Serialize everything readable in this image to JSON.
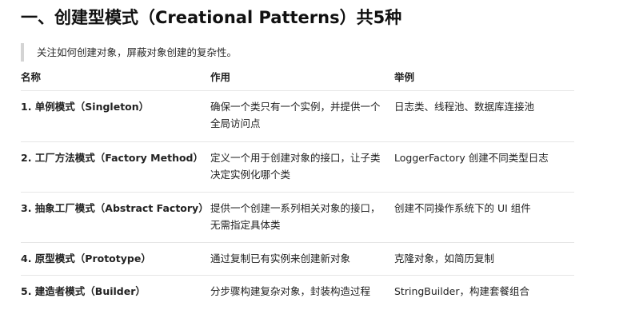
{
  "title": "一、创建型模式（Creational Patterns）共5种",
  "quote": "关注如何创建对象，屏蔽对象创建的复杂性。",
  "table": {
    "headers": [
      "名称",
      "作用",
      "举例"
    ],
    "rows": [
      {
        "name": "1. 单例模式（Singleton）",
        "purpose": "确保一个类只有一个实例，并提供一个全局访问点",
        "example": "日志类、线程池、数据库连接池"
      },
      {
        "name": "2. 工厂方法模式（Factory Method）",
        "purpose": "定义一个用于创建对象的接口，让子类决定实例化哪个类",
        "example": "LoggerFactory 创建不同类型日志"
      },
      {
        "name": "3. 抽象工厂模式（Abstract Factory）",
        "purpose": "提供一个创建一系列相关对象的接口，无需指定具体类",
        "example": "创建不同操作系统下的 UI 组件"
      },
      {
        "name": "4. 原型模式（Prototype）",
        "purpose": "通过复制已有实例来创建新对象",
        "example": "克隆对象，如简历复制"
      },
      {
        "name": "5. 建造者模式（Builder）",
        "purpose": "分步骤构建复杂对象，封装构造过程",
        "example": "StringBuilder，构建套餐组合"
      }
    ]
  }
}
